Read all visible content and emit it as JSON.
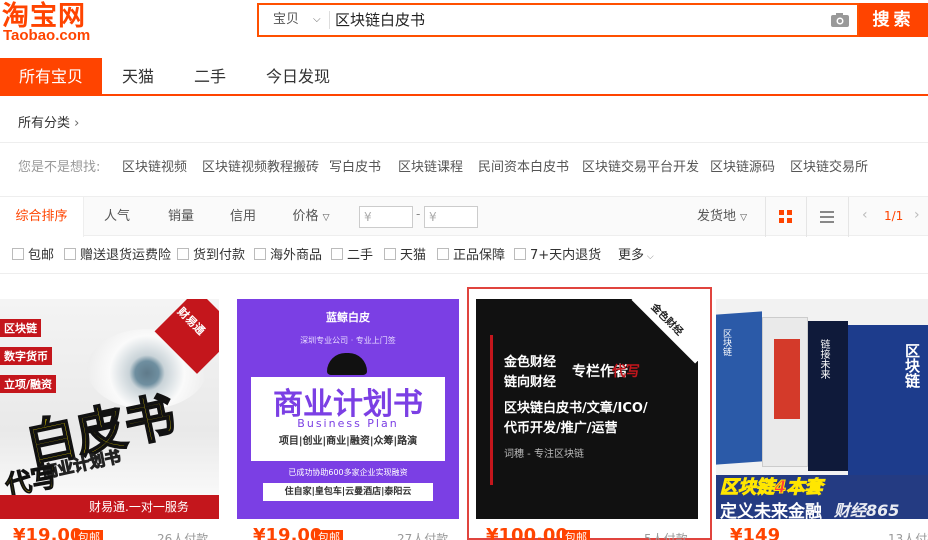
{
  "logo": {
    "cn": "淘宝网",
    "en": "Taobao.com"
  },
  "search": {
    "scope": "宝贝",
    "query": "区块链白皮书",
    "button": "搜索"
  },
  "tabs": [
    "所有宝贝",
    "天猫",
    "二手",
    "今日发现"
  ],
  "breadcrumb": "所有分类",
  "guess": {
    "label": "您是不是想找:",
    "items": [
      "区块链视频",
      "区块链视频教程搬砖",
      "写白皮书",
      "区块链课程",
      "民间资本白皮书",
      "区块链交易平台开发",
      "区块链源码",
      "区块链交易所"
    ]
  },
  "sort": {
    "items": [
      "综合排序",
      "人气",
      "销量",
      "信用",
      "价格"
    ],
    "price_from": "¥",
    "price_to": "¥",
    "dash": "-",
    "ship": "发货地",
    "page": "1/1"
  },
  "filters": [
    "包邮",
    "赠送退货运费险",
    "货到付款",
    "海外商品",
    "二手",
    "天猫",
    "正品保障",
    "7+天内退货"
  ],
  "more": "更多",
  "products": [
    {
      "badge": "财易通",
      "tags": [
        "区块链",
        "数字货币",
        "立项/融资"
      ],
      "big": "白皮书",
      "sub": "商业计划书",
      "write": "代写",
      "footer": "财易通.一对一服务",
      "price": "¥19.00",
      "tag": "包邮",
      "pay": "26人付款"
    },
    {
      "brand": "蓝鲸白皮",
      "slogan": "深圳专业公司 · 专业上门签",
      "title": "商业计划书",
      "title_en": "Business Plan",
      "line1": "项目|创业|商业|融资|众筹|路演",
      "line2": "已成功协助600多家企业实现融资",
      "line3": "住自家|皇包车|云曼酒店|泰阳云",
      "price": "¥19.00",
      "tag": "包邮",
      "pay": "27人付款"
    },
    {
      "badge": "金色财经",
      "l1": "金色财经",
      "l2": "链向财经",
      "l3": "专栏作者",
      "l3b": "代写",
      "l4": "区块链白皮书/文章/ICO/",
      "l5": "代币开发/推广/运营",
      "l6": "词穗 - 专注区块链",
      "price": "¥100.00",
      "tag": "包邮",
      "pay": "5人付款"
    },
    {
      "books": [
        "区块链",
        "链接未来",
        "区块链",
        "区块链"
      ],
      "banner": "区块链4本套",
      "banner2": "定义未来金融",
      "watermark": "财经865",
      "price": "¥149",
      "pay": "13人付款"
    }
  ],
  "colors": {
    "brand": "#ff4400",
    "purple": "#7b3fe4",
    "black": "#111111"
  }
}
